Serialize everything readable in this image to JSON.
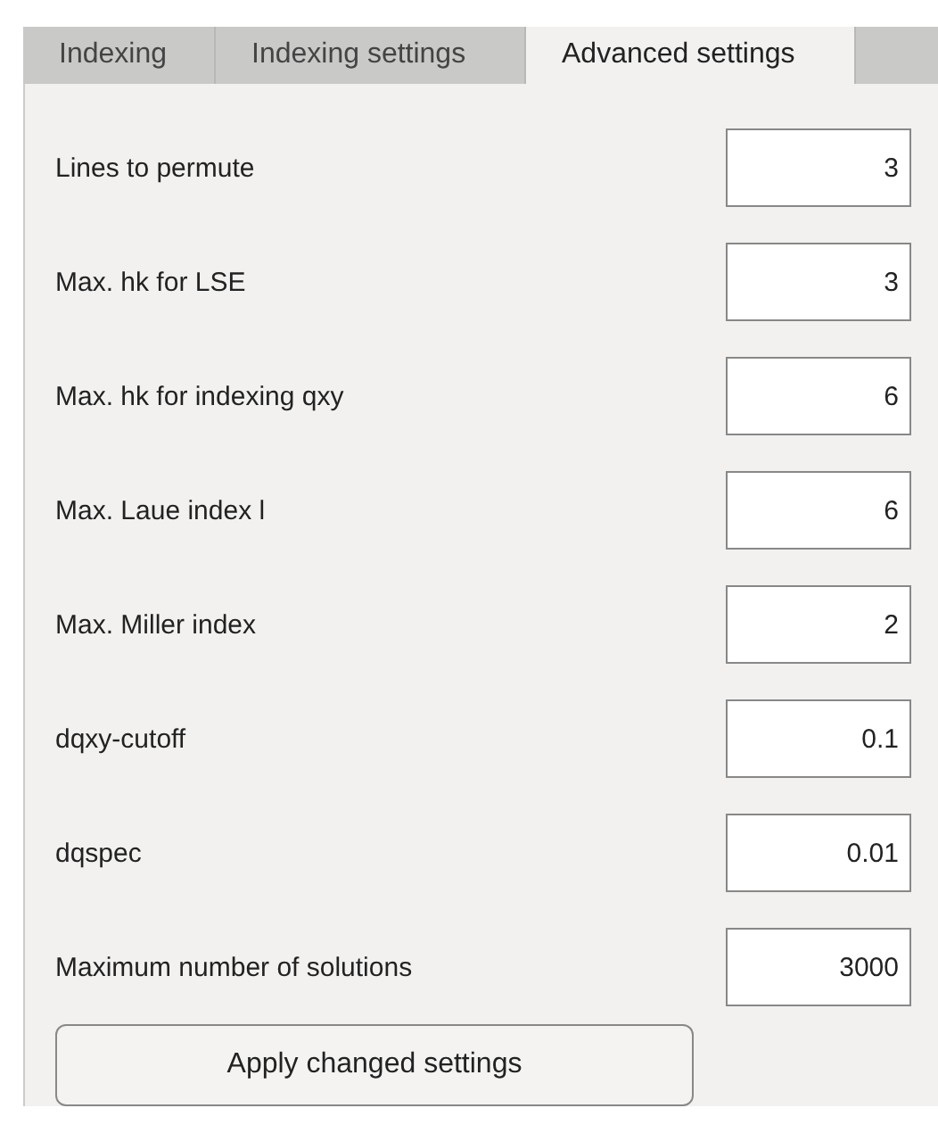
{
  "tabs": [
    {
      "label": "Indexing",
      "selected": false
    },
    {
      "label": "Indexing settings",
      "selected": false
    },
    {
      "label": "Advanced settings",
      "selected": true
    }
  ],
  "fields": [
    {
      "label": "Lines to permute",
      "value": "3"
    },
    {
      "label": "Max. hk for LSE",
      "value": "3"
    },
    {
      "label": "Max. hk for indexing qxy",
      "value": "6"
    },
    {
      "label": "Max. Laue index l",
      "value": "6"
    },
    {
      "label": "Max. Miller index",
      "value": "2"
    },
    {
      "label": "dqxy-cutoff",
      "value": "0.1"
    },
    {
      "label": "dqspec",
      "value": "0.01"
    },
    {
      "label": "Maximum number of solutions",
      "value": "3000"
    }
  ],
  "apply_button": "Apply changed settings"
}
